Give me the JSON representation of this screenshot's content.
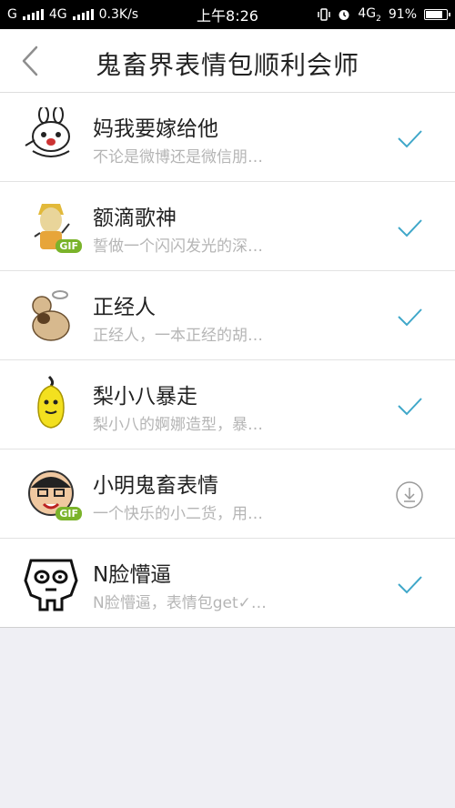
{
  "status_bar": {
    "carrier_1": "G",
    "network_2": "4G",
    "speed": "0.3K/s",
    "time": "上午8:26",
    "net_right": "4G",
    "net_right_sub": "2",
    "battery": "91%",
    "battery_level": 0.91
  },
  "nav": {
    "title": "鬼畜界表情包顺利会师"
  },
  "items": [
    {
      "title": "妈我要嫁给他",
      "subtitle": "不论是微博还是微信朋…",
      "status": "downloaded"
    },
    {
      "title": "额滴歌神",
      "subtitle": "誓做一个闪闪发光的深…",
      "status": "downloaded",
      "badge": "GIF"
    },
    {
      "title": "正经人",
      "subtitle": "正经人，一本正经的胡…",
      "status": "downloaded"
    },
    {
      "title": "梨小八暴走",
      "subtitle": "梨小八的婀娜造型，暴…",
      "status": "downloaded"
    },
    {
      "title": "小明鬼畜表情",
      "subtitle": "一个快乐的小二货，用…",
      "status": "download",
      "badge": "GIF"
    },
    {
      "title": "N脸懵逼",
      "subtitle": "N脸懵逼，表情包get✓…",
      "status": "downloaded"
    }
  ],
  "colors": {
    "accent": "#3fa7c9",
    "subtitle": "#b5b5b5",
    "background": "#efeff4"
  }
}
